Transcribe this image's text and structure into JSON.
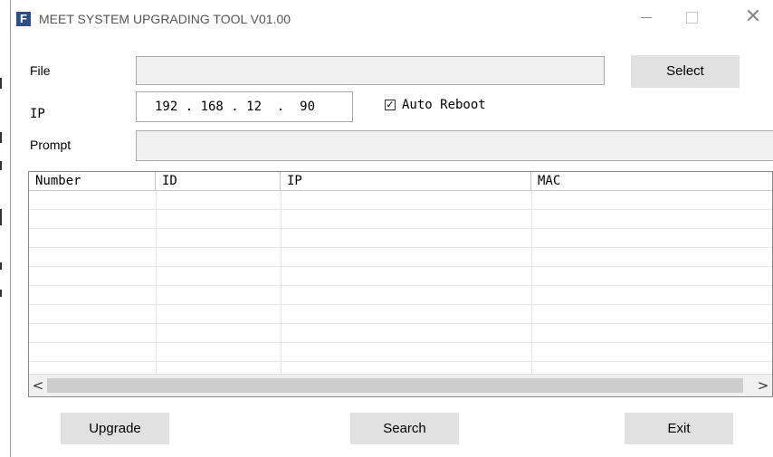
{
  "window": {
    "title": "MEET SYSTEM UPGRADING TOOL V01.00",
    "app_icon_glyph": "F",
    "app_icon_color": "#2b4f86"
  },
  "form": {
    "file_label": "File",
    "file_value": "",
    "select_label": "Select",
    "ip_label": "IP",
    "ip_value": "192 . 168 . 12  .  90",
    "auto_reboot_label": "Auto Reboot",
    "auto_reboot_checked": true,
    "prompt_label": "Prompt",
    "prompt_value": ""
  },
  "table": {
    "columns": [
      "Number",
      "ID",
      "IP",
      "MAC"
    ],
    "rows": []
  },
  "scrollbar": {
    "left_arrow": "<",
    "right_arrow": ">"
  },
  "footer": {
    "upgrade_label": "Upgrade",
    "search_label": "Search",
    "exit_label": "Exit"
  }
}
